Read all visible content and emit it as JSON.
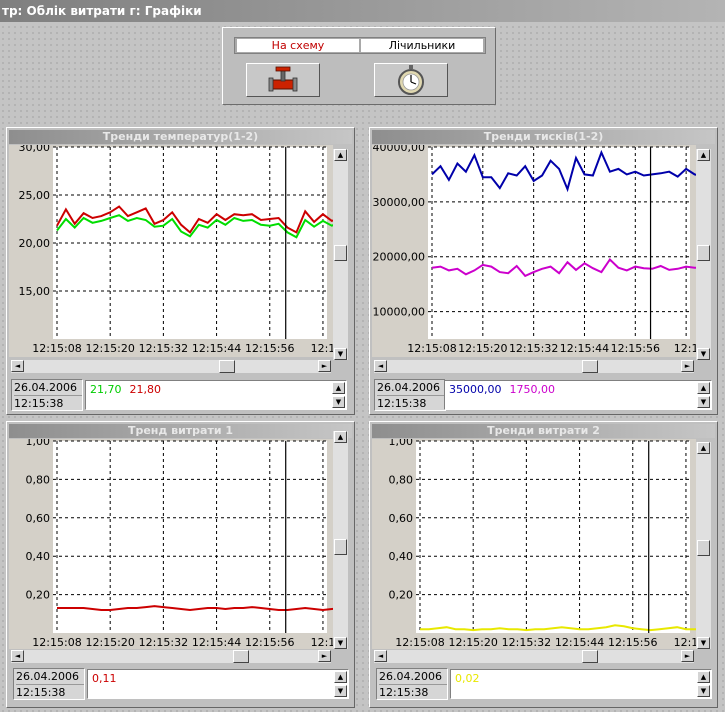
{
  "window": {
    "title": "тр: Облік витрати г: Графіки"
  },
  "toolbar": {
    "tabs": [
      {
        "label": "На схему"
      },
      {
        "label": "Лічильники"
      }
    ],
    "buttons": [
      {
        "icon": "valve-icon"
      },
      {
        "icon": "stopwatch-icon"
      }
    ]
  },
  "panels": [
    {
      "title": "Тренди температур(1-2)",
      "date": "26.04.2006",
      "time": "12:15:38",
      "values": [
        {
          "text": "21,70",
          "color": "#00cc00"
        },
        {
          "text": "21,80",
          "color": "#cc0000"
        }
      ]
    },
    {
      "title": "Тренди тисків(1-2)",
      "date": "26.04.2006",
      "time": "12:15:38",
      "values": [
        {
          "text": "35000,00",
          "color": "#0000aa"
        },
        {
          "text": "1750,00",
          "color": "#cc00cc"
        }
      ]
    },
    {
      "title": "Тренд витрати 1",
      "date": "26.04.2006",
      "time": "12:15:38",
      "values": [
        {
          "text": "0,11",
          "color": "#cc0000"
        }
      ]
    },
    {
      "title": "Тренди витрати 2",
      "date": "26.04.2006",
      "time": "12:15:38",
      "values": [
        {
          "text": "0,02",
          "color": "#e8e800"
        }
      ]
    }
  ],
  "chart_data": [
    {
      "type": "line",
      "x_ticks": [
        "12:15:08",
        "12:15:20",
        "12:15:32",
        "12:15:44",
        "12:15:56",
        "12:1"
      ],
      "y_ticks": [
        "30,00",
        "25,00",
        "20,00",
        "15,00"
      ],
      "ylim": [
        10,
        30
      ],
      "grid": true,
      "cursor_time_index": 25.8,
      "series": [
        {
          "color": "#00dd00",
          "values": [
            21.3,
            22.5,
            21.6,
            22.6,
            22.1,
            22.3,
            22.6,
            22.9,
            22.3,
            22.6,
            22.4,
            21.7,
            21.8,
            22.5,
            21.2,
            20.7,
            21.9,
            21.6,
            22.4,
            21.9,
            22.6,
            22.3,
            22.4,
            21.9,
            21.8,
            22.0,
            21.1,
            20.6,
            22.4,
            21.7,
            22.3,
            21.8,
            22.2,
            21.4,
            21.0,
            21.6,
            21.2,
            22.1,
            21.7
          ]
        },
        {
          "color": "#cc0000",
          "values": [
            21.8,
            23.5,
            22.0,
            23.1,
            22.6,
            22.8,
            23.2,
            23.8,
            22.8,
            23.2,
            23.6,
            22.0,
            22.4,
            23.2,
            21.9,
            21.1,
            22.5,
            22.1,
            23.0,
            22.4,
            23.0,
            22.9,
            23.0,
            22.4,
            22.5,
            22.6,
            21.6,
            21.1,
            23.3,
            22.2,
            23.0,
            22.3,
            22.6,
            21.7,
            21.6,
            22.1,
            21.6,
            22.5,
            22.2
          ]
        }
      ]
    },
    {
      "type": "line",
      "x_ticks": [
        "12:15:08",
        "12:15:20",
        "12:15:32",
        "12:15:44",
        "12:15:56",
        "12:1"
      ],
      "y_ticks": [
        "40000,00",
        "30000,00",
        "20000,00",
        "10000,00"
      ],
      "ylim": [
        5000,
        40000
      ],
      "grid": true,
      "cursor_time_index": 25.8,
      "series": [
        {
          "color": "#0000aa",
          "values": [
            35000,
            36500,
            34000,
            37000,
            35500,
            38500,
            34500,
            34500,
            32500,
            35200,
            34800,
            36500,
            33800,
            34800,
            37500,
            36000,
            32300,
            38000,
            35000,
            34800,
            39000,
            35500,
            36000,
            35000,
            35500,
            34800,
            35000,
            35200,
            35500,
            34600,
            36000,
            35000,
            34600,
            36500,
            35500,
            34800,
            36000,
            33500,
            34800
          ]
        },
        {
          "color": "#cc00cc",
          "values": [
            18000,
            18200,
            17500,
            17800,
            16800,
            17500,
            18500,
            18200,
            17200,
            17000,
            18300,
            16500,
            17200,
            17800,
            18200,
            17000,
            19000,
            17600,
            18800,
            17900,
            17200,
            19500,
            18000,
            17500,
            18200,
            17900,
            17800,
            18300,
            17600,
            17800,
            18200,
            18000,
            17900,
            17700,
            18200,
            17800,
            18400,
            17900,
            17500
          ]
        }
      ]
    },
    {
      "type": "line",
      "x_ticks": [
        "12:15:08",
        "12:15:20",
        "12:15:32",
        "12:15:44",
        "12:15:56",
        "12:1"
      ],
      "y_ticks": [
        "1,00",
        "0,80",
        "0,60",
        "0,40",
        "0,20"
      ],
      "ylim": [
        0,
        1
      ],
      "grid": true,
      "cursor_time_index": 25.8,
      "series": [
        {
          "color": "#cc0000",
          "values": [
            0.13,
            0.13,
            0.13,
            0.13,
            0.125,
            0.12,
            0.12,
            0.125,
            0.13,
            0.13,
            0.135,
            0.14,
            0.135,
            0.13,
            0.125,
            0.12,
            0.125,
            0.13,
            0.13,
            0.125,
            0.13,
            0.13,
            0.135,
            0.13,
            0.125,
            0.12,
            0.12,
            0.125,
            0.13,
            0.125,
            0.12,
            0.125,
            0.13,
            0.13,
            0.125,
            0.12,
            0.125,
            0.13,
            0.13
          ]
        }
      ]
    },
    {
      "type": "line",
      "x_ticks": [
        "12:15:08",
        "12:15:20",
        "12:15:32",
        "12:15:44",
        "12:15:56",
        "12:1"
      ],
      "y_ticks": [
        "1,00",
        "0,80",
        "0,60",
        "0,40",
        "0,20"
      ],
      "ylim": [
        0,
        1
      ],
      "grid": true,
      "cursor_time_index": 25.8,
      "series": [
        {
          "color": "#e8e800",
          "values": [
            0.02,
            0.02,
            0.025,
            0.03,
            0.02,
            0.02,
            0.015,
            0.02,
            0.02,
            0.025,
            0.02,
            0.02,
            0.015,
            0.02,
            0.02,
            0.025,
            0.03,
            0.025,
            0.02,
            0.02,
            0.025,
            0.03,
            0.04,
            0.035,
            0.025,
            0.02,
            0.015,
            0.02,
            0.025,
            0.03,
            0.02,
            0.02,
            0.02,
            0.02,
            0.02,
            0.02,
            0.02,
            0.02,
            0.02
          ]
        }
      ]
    }
  ]
}
